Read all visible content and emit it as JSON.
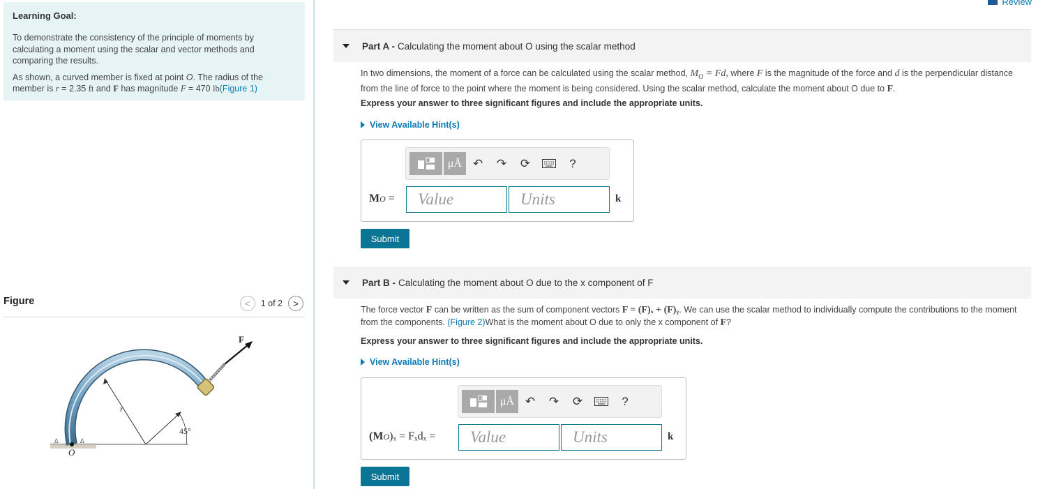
{
  "header": {
    "review_label": "Review"
  },
  "learning_goal": {
    "title": "Learning Goal:",
    "para1": "To demonstrate the consistency of the principle of moments by calculating a moment using the scalar and vector methods and comparing the results.",
    "para2_a": "As shown, a curved member is fixed at point ",
    "para2_O": "O",
    "para2_b": ". The radius of the member is ",
    "r_sym": "r",
    "r_eq": " = 2.35 ",
    "r_unit": "ft",
    "and_txt": " and ",
    "F_bold": "F",
    "mag_txt": " has magnitude ",
    "F_ital": "F",
    "F_eq": " = 470 ",
    "F_unit": "lb",
    "fig_link": "(Figure 1)"
  },
  "figure_panel": {
    "title": "Figure",
    "pager": "1 of 2",
    "prev_icon": "<",
    "next_icon": ">",
    "labels": {
      "force": "F",
      "radius": "r",
      "angle": "45°",
      "origin": "O"
    }
  },
  "part_a": {
    "label": "Part A -",
    "title": "Calculating the moment about O using the scalar method",
    "text1": "In two dimensions, the moment of a force can be calculated using the scalar method, ",
    "eq1": "M",
    "eq1_sub": "O",
    "eq1_rest": " = Fd,",
    "text2": " where ",
    "F": "F",
    "text3": " is the magnitude of the force and ",
    "d": "d",
    "text4": " is the perpendicular distance from the line of force to the point where the moment is being considered. Using the scalar method, calculate the moment about O due to ",
    "F_bold": "F",
    "period": ".",
    "instructions": "Express your answer to three significant figures and include the appropriate units.",
    "hint": "View Available Hint(s)",
    "input_label": "M",
    "input_label_sub": "O",
    "input_label_eq": " =",
    "value_placeholder": "Value",
    "units_placeholder": "Units",
    "unit_suffix": "k",
    "submit": "Submit"
  },
  "part_b": {
    "label": "Part B -",
    "title": "Calculating the moment about O due to the x component of F",
    "text1": "The force vector ",
    "F_bold": "F",
    "text2": " can be written as the sum of component vectors ",
    "eq": "F = (F)ₓ + (F)ᵧ",
    "text3": ". We can use the scalar method to individually compute the contributions to the moment from the components. ",
    "fig_link": "(Figure 2)",
    "text4": "What is the moment about O due to only the x component of ",
    "F_bold2": "F",
    "qmark": "?",
    "instructions": "Express your answer to three significant figures and include the appropriate units.",
    "hint": "View Available Hint(s)",
    "input_label": "(M",
    "input_label_sub": "O",
    "input_label_rest": ")ₓ = Fₓdₓ =",
    "value_placeholder": "Value",
    "units_placeholder": "Units",
    "unit_suffix": "k",
    "submit": "Submit"
  },
  "toolbar": {
    "mu_label": "μÅ",
    "undo_icon": "undo-icon",
    "redo_icon": "redo-icon",
    "reset_icon": "reset-icon",
    "keyboard_icon": "keyboard-icon",
    "help_label": "?"
  }
}
